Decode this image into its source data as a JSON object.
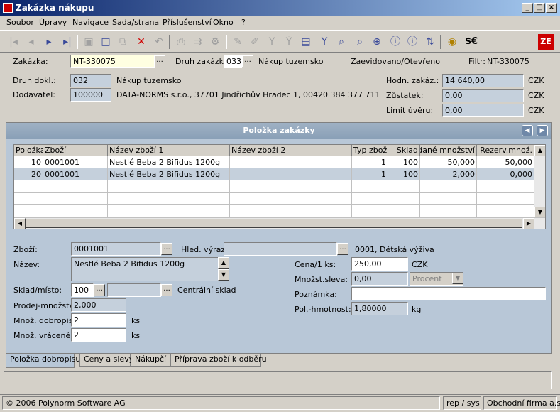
{
  "window": {
    "title": "Zakázka nákupu"
  },
  "menu": [
    "Soubor",
    "Úpravy",
    "Navigace",
    "Sada/strana",
    "Příslušenství",
    "Okno",
    "?"
  ],
  "toolbar": {
    "currency": "$€"
  },
  "header": {
    "zakazka_label": "Zakázka:",
    "zakazka_value": "NT-330075",
    "druh_zakazk_label": "Druh zakázk:",
    "druh_zakazk_value": "033",
    "druh_zakazk_text": "Nákup tuzemsko",
    "status_text": "Zaevidovano/Otevřeno",
    "filter_label": "Filtr:",
    "filter_value": "NT-330075",
    "druh_dokl_label": "Druh dokl.:",
    "druh_dokl_value": "032",
    "druh_dokl_text": "Nákup tuzemsko",
    "dodavatel_label": "Dodavatel:",
    "dodavatel_value": "100000",
    "dodavatel_text": "DATA-NORMS s.r.o., 37701 Jindřichův Hradec 1, 00420 384 377 711",
    "hodn_label": "Hodn. zakáz.:",
    "hodn_value": "14 640,00",
    "hodn_cur": "CZK",
    "zustatek_label": "Zůstatek:",
    "zustatek_value": "0,00",
    "zustatek_cur": "CZK",
    "limit_label": "Limit úvěru:",
    "limit_value": "0,00",
    "limit_cur": "CZK"
  },
  "panel": {
    "title": "Položka zakázky"
  },
  "grid": {
    "columns": [
      "Položka",
      "Zboží",
      "Název zboží 1",
      "Název zboží 2",
      "Typ zboží",
      "Sklad",
      "Prodané množství",
      "Rezerv.množ."
    ],
    "rows": [
      [
        "10",
        "0001001",
        "Nestlé Beba 2 Bifidus 1200g",
        "",
        "1",
        "100",
        "50,000",
        "50,000"
      ],
      [
        "20",
        "0001001",
        "Nestlé Beba 2 Bifidus 1200g",
        "",
        "1",
        "100",
        "2,000",
        "0,000"
      ]
    ]
  },
  "detail": {
    "zbozi_label": "Zboží:",
    "zbozi_value": "0001001",
    "hled_label": "Hled. výraz:",
    "hled_value": "",
    "hled_text": "0001, Dětská výživa",
    "nazev_label": "Název:",
    "nazev_value": "Nestlé Beba 2 Bifidus 1200g",
    "sklad_label": "Sklad/místo:",
    "sklad_value": "100",
    "sklad_text": "Centrální sklad",
    "prodej_label": "Prodej-množství:",
    "prodej_value": "2,000",
    "dobropis_label": "Množ. dobropis.:",
    "dobropis_value": "2",
    "dobropis_unit": "ks",
    "vracene_label": "Množ. vrácené:",
    "vracene_value": "2",
    "vracene_unit": "ks",
    "cena_label": "Cena/1 ks:",
    "cena_value": "250,00",
    "cena_cur": "CZK",
    "sleva_label": "Množst.sleva:",
    "sleva_value": "0,00",
    "sleva_type": "Procent",
    "poznamka_label": "Poznámka:",
    "poznamka_value": "",
    "hmotnost_label": "Pol.-hmotnost:",
    "hmotnost_value": "1,80000",
    "hmotnost_unit": "kg"
  },
  "tabs": [
    "Položka dobropisu",
    "Ceny a slevy",
    "Nákupčí",
    "Příprava zboží k odběru"
  ],
  "status": {
    "copyright": "© 2006 Polynorm Software AG",
    "user": "rep / sys",
    "company": "Obchodní firma a.s."
  }
}
